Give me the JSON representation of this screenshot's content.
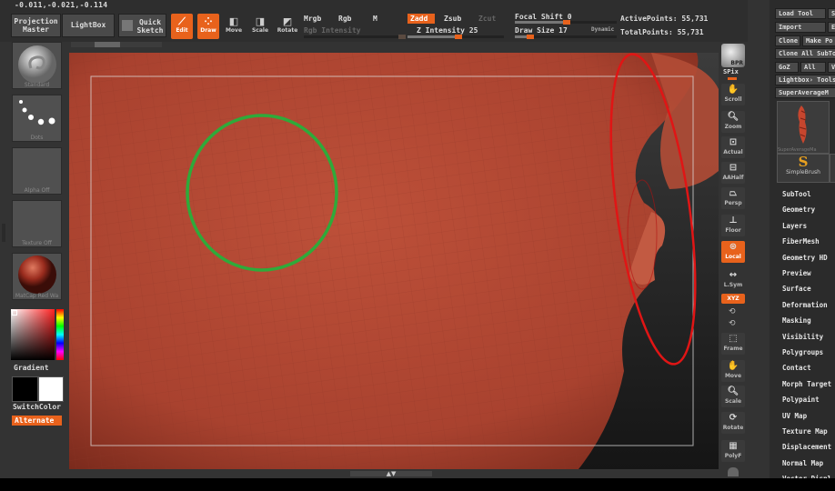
{
  "coords": "-0.011,-0.021,-0.114",
  "top": {
    "projection_master": "Projection Master",
    "lightbox": "LightBox",
    "quick_sketch": "Quick Sketch",
    "edit": "Edit",
    "draw": "Draw",
    "move": "Move",
    "scale": "Scale",
    "rotate": "Rotate",
    "mrgb": "Mrgb",
    "rgb": "Rgb",
    "m": "M",
    "rgb_intensity": "Rgb Intensity",
    "zadd": "Zadd",
    "zsub": "Zsub",
    "zcut": "Zcut",
    "z_intensity": "Z Intensity 25",
    "focal_shift": "Focal Shift 0",
    "draw_size": "Draw Size 17",
    "dynamic": "Dynamic",
    "active_points": "ActivePoints: 55,731",
    "total_points": "TotalPoints: 55,731",
    "z_intensity_value": 25,
    "draw_size_value": 17,
    "focal_shift_value": 0
  },
  "left": {
    "standard": "Standard",
    "dots": "Dots",
    "alpha": "Alpha  Off",
    "texture": "Texture  Off",
    "matcap": "MatCap  Red  Wa",
    "gradient": "Gradient",
    "switchcolor": "SwitchColor",
    "alternate": "Alternate"
  },
  "right": {
    "bpr": "BPR",
    "spix": "SPix",
    "scroll": "Scroll",
    "zoom": "Zoom",
    "actual": "Actual",
    "aahalf": "AAHalf",
    "persp": "Persp",
    "floor": "Floor",
    "local": "Local",
    "lsym": "L.Sym",
    "xyz": "XYZ",
    "frame": "Frame",
    "move": "Move",
    "scale": "Scale",
    "rotate": "Rotate",
    "polyf": "PolyF"
  },
  "tool": {
    "load": "Load Tool",
    "save": "S",
    "import": "Import",
    "export": "E",
    "clone": "Clone",
    "make": "Make Po",
    "clone_all": "Clone All SubTo",
    "goz": "GoZ",
    "all": "All",
    "v": "V",
    "lightbox_tools": "Lightbox› Tools",
    "current": "SuperAverageM",
    "thumb_caption": "SuperAverageMa",
    "simplebrush": "SimpleBrush",
    "menu": [
      "SubTool",
      "Geometry",
      "Layers",
      "FiberMesh",
      "Geometry HD",
      "Preview",
      "Surface",
      "Deformation",
      "Masking",
      "Visibility",
      "Polygroups",
      "Contact",
      "Morph Target",
      "Polypaint",
      "UV Map",
      "Texture Map",
      "Displacement",
      "Normal Map",
      "Vector Displ"
    ]
  },
  "colors": {
    "accent": "#e8621c",
    "mesh": "#b04a35",
    "circle_green": "#2faa3a",
    "circle_red": "#e01515"
  }
}
